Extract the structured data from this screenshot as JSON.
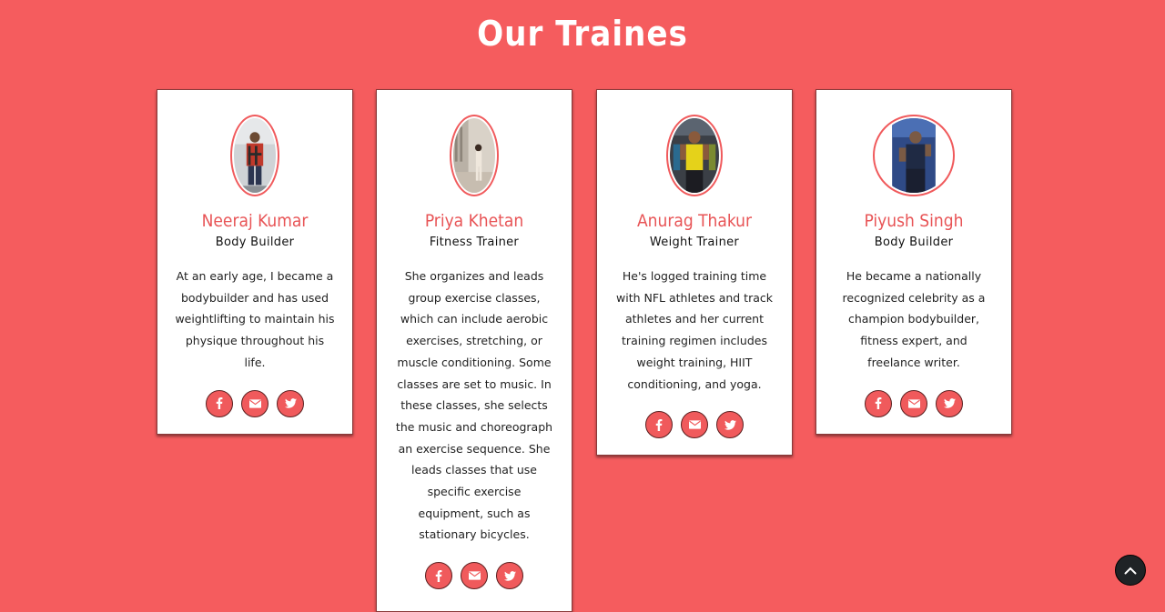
{
  "section": {
    "title": "Our Traines"
  },
  "trainers": [
    {
      "name": "Neeraj Kumar",
      "role": "Body Builder",
      "bio": "At an early age, I became a bodybuilder and has used weightlifting to maintain his physique throughout his life."
    },
    {
      "name": "Priya Khetan",
      "role": "Fitness Trainer",
      "bio": "She organizes and leads group exercise classes, which can include aerobic exercises, stretching, or muscle conditioning. Some classes are set to music. In these classes, she selects the music and choreograph an exercise sequence. She leads classes that use specific exercise equipment, such as stationary bicycles."
    },
    {
      "name": "Anurag Thakur",
      "role": "Weight Trainer",
      "bio": "He's logged training time with NFL athletes and track athletes and her current training regimen includes weight training, HIIT conditioning, and yoga."
    },
    {
      "name": "Piyush Singh",
      "role": "Body Builder",
      "bio": "He became a nationally recognized celebrity as a champion bodybuilder, fitness expert, and freelance writer."
    }
  ],
  "social_icons": [
    "facebook-icon",
    "envelope-icon",
    "twitter-icon"
  ],
  "back_to_top_icon": "chevron-up-icon",
  "colors": {
    "background": "#f55c5e",
    "accent": "#f05a5c",
    "name": "#e85456",
    "back_to_top": "#1f2326"
  }
}
